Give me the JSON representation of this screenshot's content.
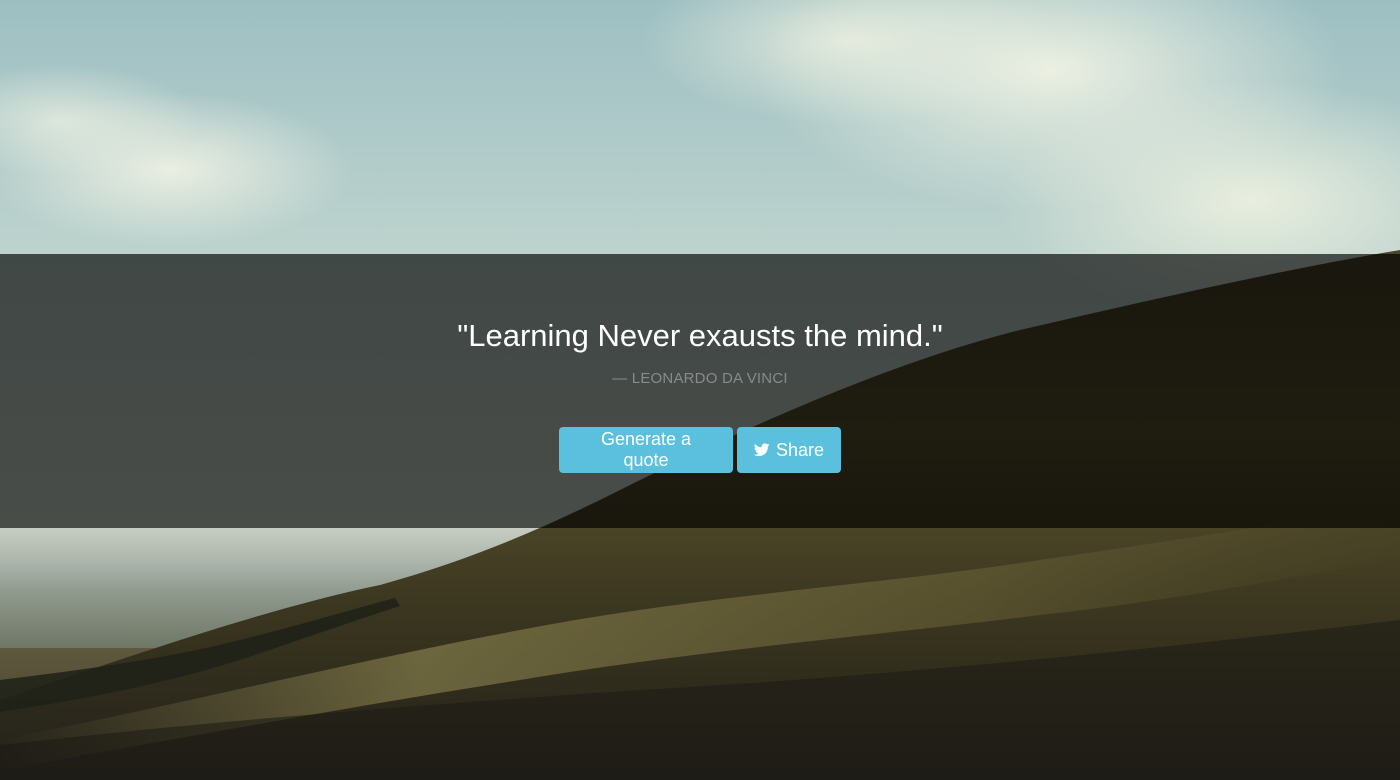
{
  "quote": {
    "text": "\"Learning Never exausts the mind.\"",
    "author": "— LEONARDO DA VINCI"
  },
  "buttons": {
    "generate_label": "Generate a quote",
    "share_label": "Share",
    "share_icon": "twitter-bird-icon",
    "color": "#5bc0de"
  },
  "overlay": {
    "color": "#000000",
    "opacity": 0.66
  }
}
